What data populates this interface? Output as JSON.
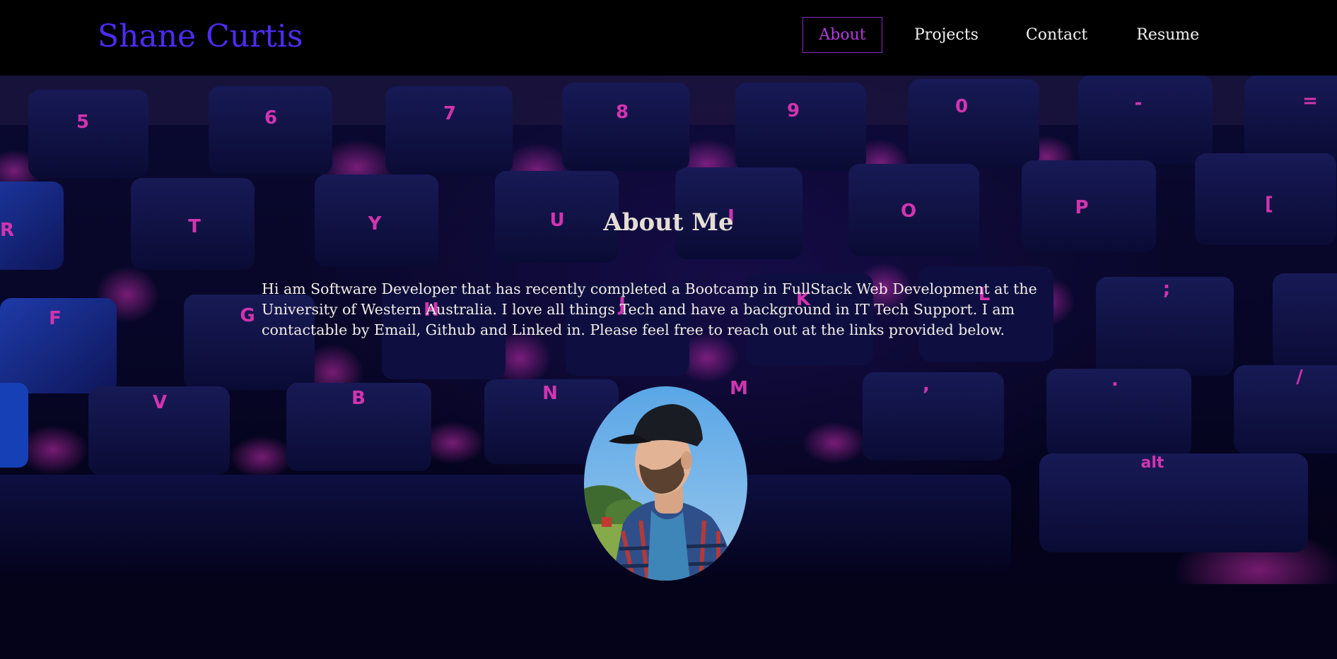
{
  "header": {
    "brand": "Shane Curtis",
    "brand_color": "#4d2cf4",
    "nav": [
      {
        "label": "About",
        "active": true
      },
      {
        "label": "Projects",
        "active": false
      },
      {
        "label": "Contact",
        "active": false
      },
      {
        "label": "Resume",
        "active": false
      }
    ],
    "active_color": "#b53be0"
  },
  "about": {
    "title": "About Me",
    "text": "Hi am Software Developer that has recently completed a Bootcamp in FullStack Web Development at the University of Western Australia. I love all things Tech and have a background in IT Tech Support. I am contactable by Email, Github and Linked in. Please feel free to reach out at the links provided below.",
    "avatar": "profile-photo"
  },
  "background": {
    "image": "keyboard-photo",
    "key_glow_color": "#ff3fd0",
    "key_legends_row1": [
      "5",
      "6",
      "7",
      "8",
      "9",
      "0",
      "-",
      "="
    ],
    "key_legends_row2": [
      "R",
      "T",
      "Y",
      "U",
      "I",
      "O",
      "P",
      "["
    ],
    "key_legends_row3": [
      "F",
      "G",
      "H",
      "J",
      "K",
      "L",
      ";"
    ],
    "key_legends_row4": [
      "V",
      "B",
      "N",
      "M",
      ",",
      ".",
      "/"
    ],
    "key_legends_mod": [
      "alt"
    ]
  }
}
